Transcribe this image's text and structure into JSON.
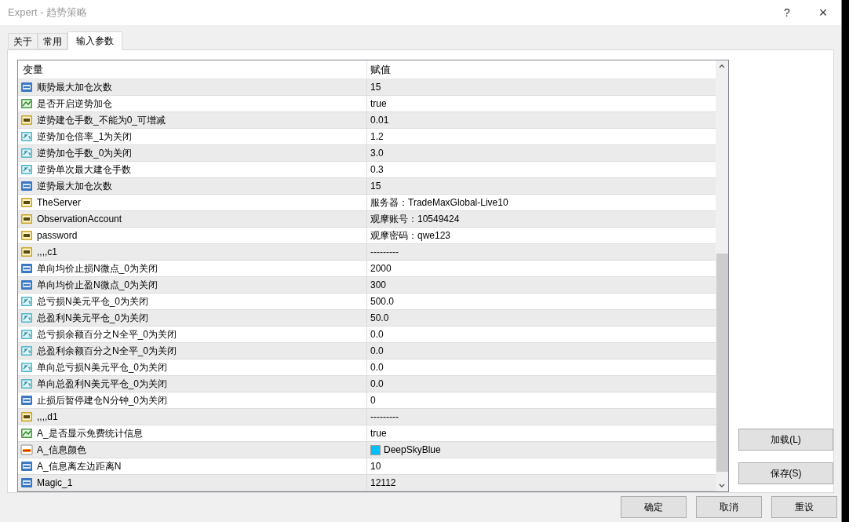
{
  "window": {
    "title": "Expert - 趋势策略",
    "help": "?",
    "close": "×"
  },
  "tabs": [
    {
      "label": "关于",
      "selected": false
    },
    {
      "label": "常用",
      "selected": false
    },
    {
      "label": "输入参数",
      "selected": true
    }
  ],
  "table": {
    "columns": [
      "变量",
      "赋值"
    ],
    "rows": [
      {
        "kind": "int",
        "name": "顺势最大加仓次数",
        "value": "15",
        "selected": false
      },
      {
        "kind": "bool",
        "name": "是否开启逆势加仓",
        "value": "true",
        "selected": false
      },
      {
        "kind": "string",
        "name": "逆势建仓手数_不能为0_可增减",
        "value": "0.01",
        "selected": false
      },
      {
        "kind": "double",
        "name": "逆势加仓倍率_1为关闭",
        "value": "1.2",
        "selected": false
      },
      {
        "kind": "double",
        "name": "逆势加仓手数_0为关闭",
        "value": "3.0",
        "selected": false
      },
      {
        "kind": "double",
        "name": "逆势单次最大建仓手数",
        "value": "0.3",
        "selected": false
      },
      {
        "kind": "int",
        "name": "逆势最大加仓次数",
        "value": "15",
        "selected": false
      },
      {
        "kind": "string",
        "name": "TheServer",
        "value": "服务器：TradeMaxGlobal-Live10",
        "selected": false
      },
      {
        "kind": "string",
        "name": "ObservationAccount",
        "value": "观摩账号：10549424",
        "selected": false
      },
      {
        "kind": "string",
        "name": "password",
        "value": "观摩密码：qwe123",
        "selected": false
      },
      {
        "kind": "string",
        "name": ",,,,c1",
        "value": "---------",
        "selected": false
      },
      {
        "kind": "int",
        "name": "单向均价止损N微点_0为关闭",
        "value": "2000",
        "selected": false
      },
      {
        "kind": "int",
        "name": "单向均价止盈N微点_0为关闭",
        "value": "300",
        "selected": false
      },
      {
        "kind": "double",
        "name": "总亏损N美元平仓_0为关闭",
        "value": "500.0",
        "selected": false
      },
      {
        "kind": "double",
        "name": "总盈利N美元平仓_0为关闭",
        "value": "50.0",
        "selected": false
      },
      {
        "kind": "double",
        "name": "总亏损余额百分之N全平_0为关闭",
        "value": "0.0",
        "selected": false
      },
      {
        "kind": "double",
        "name": "总盈利余额百分之N全平_0为关闭",
        "value": "0.0",
        "selected": false
      },
      {
        "kind": "double",
        "name": "单向总亏损N美元平仓_0为关闭",
        "value": "0.0",
        "selected": false
      },
      {
        "kind": "double",
        "name": "单向总盈利N美元平仓_0为关闭",
        "value": "0.0",
        "selected": false
      },
      {
        "kind": "int",
        "name": "止损后暂停建仓N分钟_0为关闭",
        "value": "0",
        "selected": false
      },
      {
        "kind": "string",
        "name": ",,,,d1",
        "value": "---------",
        "selected": false
      },
      {
        "kind": "bool",
        "name": "A_是否显示免费统计信息",
        "value": "true",
        "selected": false
      },
      {
        "kind": "color",
        "name": "A_信息颜色",
        "value": "DeepSkyBlue",
        "color": "#00bfff",
        "selected": false
      },
      {
        "kind": "int",
        "name": "A_信息离左边距离N",
        "value": "10",
        "selected": false
      },
      {
        "kind": "int",
        "name": "Magic_1",
        "value": "12112",
        "selected": false
      }
    ]
  },
  "side_buttons": [
    "加载(L)",
    "保存(S)"
  ],
  "footer_buttons": [
    "确定",
    "取消",
    "重设"
  ]
}
